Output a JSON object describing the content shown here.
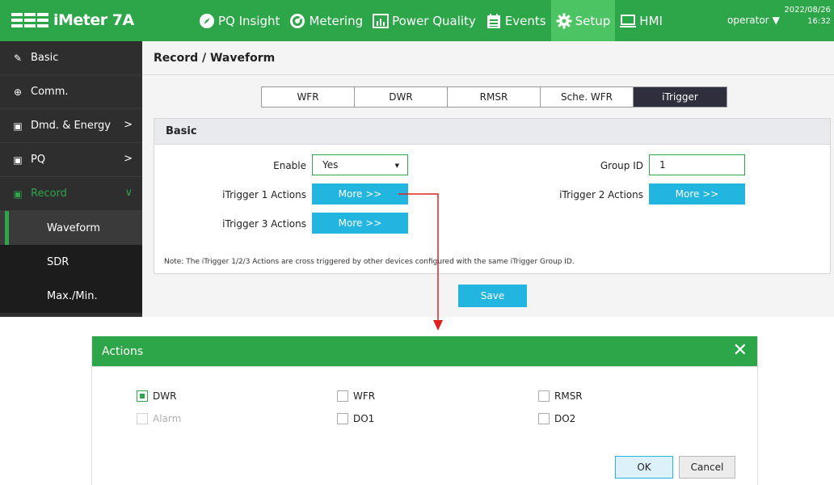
{
  "app": {
    "name": "iMeter 7A",
    "user": "operator",
    "date": "2022/08/26",
    "time": "16:32"
  },
  "nav": [
    {
      "label": "PQ Insight",
      "icon": "compass-icon"
    },
    {
      "label": "Metering",
      "icon": "gauge-icon"
    },
    {
      "label": "Power Quality",
      "icon": "bar-chart-icon"
    },
    {
      "label": "Events",
      "icon": "calendar-list-icon"
    },
    {
      "label": "Setup",
      "icon": "gear-icon",
      "active": true
    },
    {
      "label": "HMI",
      "icon": "monitor-icon"
    }
  ],
  "sidebar": {
    "items": [
      {
        "label": "Basic",
        "icon": "wrench-icon"
      },
      {
        "label": "Comm.",
        "icon": "globe-icon"
      },
      {
        "label": "Dmd. & Energy",
        "icon": "meter-icon",
        "chevron": ">"
      },
      {
        "label": "PQ",
        "icon": "meter-icon",
        "chevron": ">"
      },
      {
        "label": "Record",
        "icon": "meter-icon",
        "chevron": "∨"
      }
    ],
    "subitems": [
      {
        "label": "Waveform",
        "active": true
      },
      {
        "label": "SDR"
      },
      {
        "label": "Max./Min."
      }
    ]
  },
  "page": {
    "title": "Record / Waveform",
    "tabs": [
      "WFR",
      "DWR",
      "RMSR",
      "Sche. WFR",
      "iTrigger"
    ],
    "active_tab": "iTrigger",
    "panel_title": "Basic",
    "fields": {
      "enable_label": "Enable",
      "enable_value": "Yes",
      "group_id_label": "Group ID",
      "group_id_value": "1",
      "itrigger1_label": "iTrigger 1 Actions",
      "itrigger2_label": "iTrigger 2 Actions",
      "itrigger3_label": "iTrigger 3 Actions",
      "more_label": "More >>"
    },
    "note": "Note: The iTrigger 1/2/3 Actions are cross triggered by other devices configured with the same iTrigger Group ID.",
    "save_label": "Save"
  },
  "dialog": {
    "title": "Actions",
    "close_glyph": "✕",
    "checkboxes": [
      {
        "label": "DWR",
        "checked": true,
        "disabled": false
      },
      {
        "label": "WFR",
        "checked": false,
        "disabled": false
      },
      {
        "label": "RMSR",
        "checked": false,
        "disabled": false
      },
      {
        "label": "Alarm",
        "checked": false,
        "disabled": true
      },
      {
        "label": "DO1",
        "checked": false,
        "disabled": false
      },
      {
        "label": "DO2",
        "checked": false,
        "disabled": false
      }
    ],
    "ok_label": "OK",
    "cancel_label": "Cancel"
  },
  "colors": {
    "brand_green": "#2ca649",
    "accent_blue": "#21b5e0",
    "connector_red": "#e02020"
  }
}
